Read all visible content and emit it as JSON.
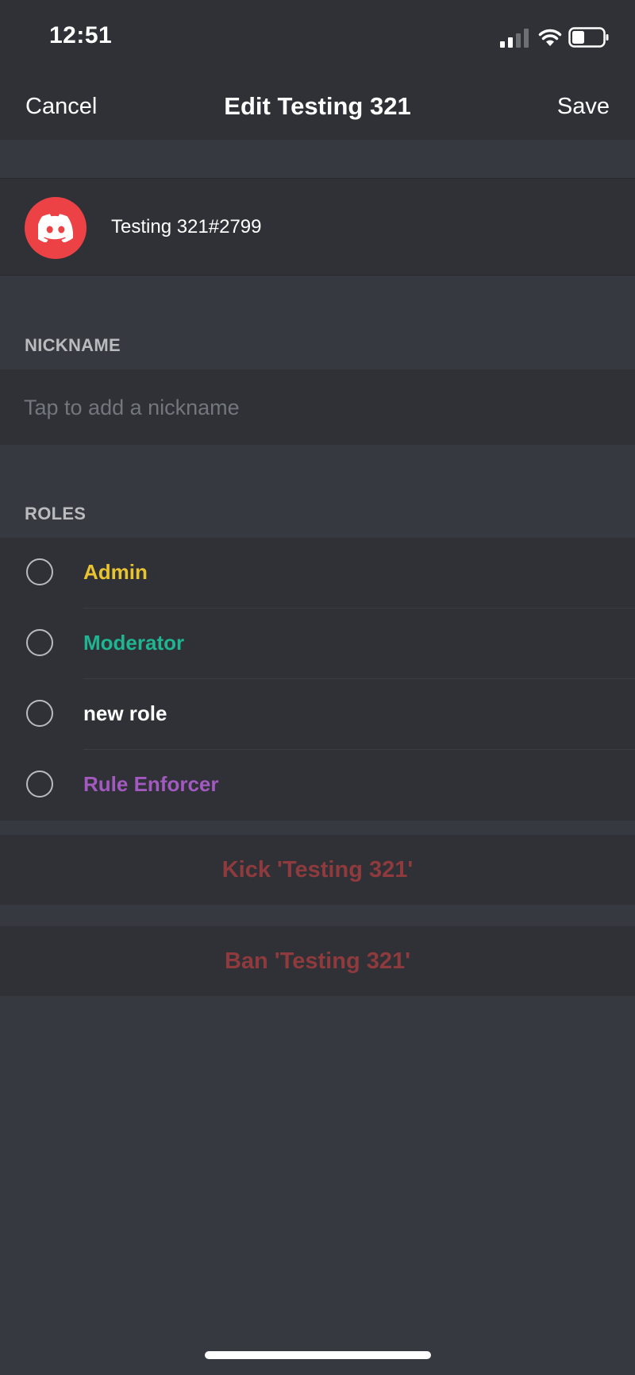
{
  "status_bar": {
    "time": "12:51"
  },
  "nav": {
    "cancel_label": "Cancel",
    "title": "Edit Testing 321",
    "save_label": "Save"
  },
  "user": {
    "tag": "Testing 321#2799",
    "avatar_icon": "discord-logo-icon",
    "avatar_color": "#ed4245"
  },
  "nickname": {
    "header": "NICKNAME",
    "placeholder": "Tap to add a nickname",
    "value": ""
  },
  "roles": {
    "header": "ROLES",
    "items": [
      {
        "name": "Admin",
        "color": "#e9c430",
        "selected": false
      },
      {
        "name": "Moderator",
        "color": "#1fb591",
        "selected": false
      },
      {
        "name": "new role",
        "color": "#ffffff",
        "selected": false
      },
      {
        "name": "Rule Enforcer",
        "color": "#a259c0",
        "selected": false
      }
    ]
  },
  "actions": {
    "kick_label": "Kick 'Testing 321'",
    "ban_label": "Ban 'Testing 321'",
    "danger_color": "#8f3a3d"
  },
  "colors": {
    "background": "#36393f",
    "surface": "#2f3136"
  }
}
